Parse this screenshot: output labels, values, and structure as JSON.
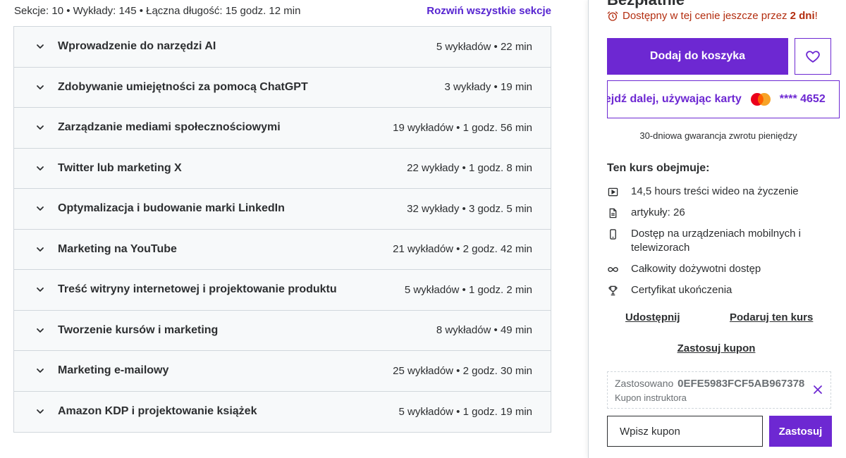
{
  "curriculum": {
    "summary": "Sekcje: 10 • Wykłady: 145 • Łączna długość: 15 godz. 12 min",
    "expand_all": "Rozwiń wszystkie sekcje",
    "sections": [
      {
        "title": "Wprowadzenie do narzędzi AI",
        "meta": "5 wykładów • 22 min"
      },
      {
        "title": "Zdobywanie umiejętności za pomocą ChatGPT",
        "meta": "3 wykłady • 19 min"
      },
      {
        "title": "Zarządzanie mediami społecznościowymi",
        "meta": "19 wykładów • 1 godz. 56 min"
      },
      {
        "title": "Twitter lub marketing X",
        "meta": "22 wykłady • 1 godz. 8 min"
      },
      {
        "title": "Optymalizacja i budowanie marki LinkedIn",
        "meta": "32 wykłady • 3 godz. 5 min"
      },
      {
        "title": "Marketing na YouTube",
        "meta": "21 wykładów • 2 godz. 42 min"
      },
      {
        "title": "Treść witryny internetowej i projektowanie produktu",
        "meta": "5 wykładów • 1 godz. 2 min"
      },
      {
        "title": "Tworzenie kursów i marketing",
        "meta": "8 wykładów • 49 min"
      },
      {
        "title": "Marketing e-mailowy",
        "meta": "25 wykładów • 2 godz. 30 min"
      },
      {
        "title": "Amazon KDP i projektowanie książek",
        "meta": "5 wykładów • 1 godz. 19 min"
      }
    ]
  },
  "purchase": {
    "price_label": "Bezpłatnie",
    "deadline_prefix": "Dostępny w tej cenie jeszcze przez ",
    "deadline_days": "2 dni",
    "deadline_suffix": "!",
    "add_to_cart": "Dodaj do koszyka",
    "card_label": "Przejdź dalej, używając karty",
    "card_number": "**** 4652",
    "guarantee": "30-dniowa gwarancja zwrotu pieniędzy",
    "includes_title": "Ten kurs obejmuje:",
    "includes": [
      {
        "icon": "video-icon",
        "text": "14,5 hours treści wideo na życzenie"
      },
      {
        "icon": "file-icon",
        "text": "artykuły: 26"
      },
      {
        "icon": "mobile-icon",
        "text": "Dostęp na urządzeniach mobilnych i telewizorach"
      },
      {
        "icon": "infinity-icon",
        "text": "Całkowity dożywotni dostęp"
      },
      {
        "icon": "trophy-icon",
        "text": "Certyfikat ukończenia"
      }
    ],
    "share": "Udostępnij",
    "gift": "Podaruj ten kurs",
    "apply_coupon_link": "Zastosuj kupon",
    "applied_prefix": "Zastosowano",
    "applied_code": "0EFE5983FCF5AB967378",
    "applied_sub": "Kupon instruktora",
    "coupon_placeholder": "Wpisz kupon",
    "coupon_apply": "Zastosuj"
  },
  "colors": {
    "accent": "#6d28d2",
    "link": "#5624d0",
    "alert": "#b32d0f",
    "section_bg": "#f7f9fa",
    "border": "#d1d7dc"
  }
}
